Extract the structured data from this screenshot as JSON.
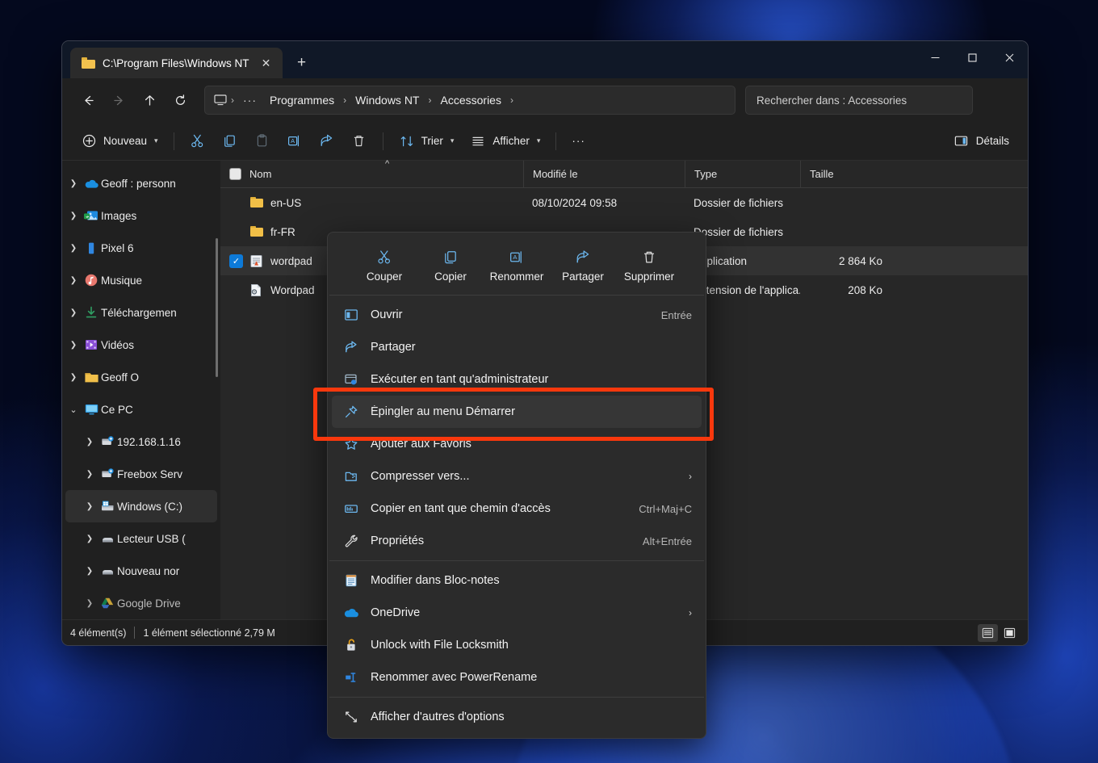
{
  "window": {
    "tab_title": "C:\\Program Files\\Windows NT",
    "tab_close_label": "✕",
    "new_tab_label": "+",
    "minimize_label": "Réduire",
    "maximize_label": "Agrandir",
    "close_label": "Fermer"
  },
  "nav": {
    "back_label": "Précédent",
    "forward_label": "Suivant",
    "up_label": "Remonter d'un niveau",
    "refresh_label": "Actualiser",
    "breadcrumb": [
      "Programmes",
      "Windows NT",
      "Accessories"
    ],
    "breadcrumb_overflow": "···",
    "separator": "›",
    "search_text": "Rechercher dans : Accessories"
  },
  "toolbar": {
    "new_label": "Nouveau",
    "cut_label": "Couper",
    "copy_label": "Copier",
    "paste_label": "Coller",
    "rename_label": "Renommer",
    "share_label": "Partager",
    "delete_label": "Supprimer",
    "sort_label": "Trier",
    "view_label": "Afficher",
    "more_label": "···",
    "details_label": "Détails"
  },
  "sidebar": {
    "items": [
      {
        "label": "Geoff : personn",
        "icon": "onedrive-cloud-icon",
        "expanded": false,
        "indent": 0,
        "selected": false
      },
      {
        "label": "Images",
        "icon": "pictures-icon",
        "expanded": false,
        "indent": 0,
        "selected": false
      },
      {
        "label": "Pixel 6",
        "icon": "phone-icon",
        "expanded": false,
        "indent": 0,
        "selected": false
      },
      {
        "label": "Musique",
        "icon": "music-icon",
        "expanded": false,
        "indent": 0,
        "selected": false
      },
      {
        "label": "Téléchargemen",
        "icon": "downloads-icon",
        "expanded": false,
        "indent": 0,
        "selected": false
      },
      {
        "label": "Vidéos",
        "icon": "videos-icon",
        "expanded": false,
        "indent": 0,
        "selected": false
      },
      {
        "label": "Geoff O",
        "icon": "folder-icon",
        "expanded": false,
        "indent": 0,
        "selected": false
      },
      {
        "label": "Ce PC",
        "icon": "this-pc-icon",
        "expanded": true,
        "indent": 0,
        "selected": false
      },
      {
        "label": "192.168.1.16",
        "icon": "network-drive-icon",
        "expanded": false,
        "indent": 1,
        "selected": false
      },
      {
        "label": "Freebox Serv",
        "icon": "network-drive-icon",
        "expanded": false,
        "indent": 1,
        "selected": false
      },
      {
        "label": "Windows (C:)",
        "icon": "windows-drive-icon",
        "expanded": false,
        "indent": 1,
        "selected": true
      },
      {
        "label": "Lecteur USB (",
        "icon": "usb-drive-icon",
        "expanded": false,
        "indent": 1,
        "selected": false
      },
      {
        "label": "Nouveau nor",
        "icon": "usb-drive-icon",
        "expanded": false,
        "indent": 1,
        "selected": false
      },
      {
        "label": "Google Drive",
        "icon": "google-drive-icon",
        "expanded": false,
        "indent": 1,
        "selected": false
      }
    ]
  },
  "filelist": {
    "columns": [
      "Nom",
      "Modifié le",
      "Type",
      "Taille"
    ],
    "rows": [
      {
        "name": "en-US",
        "modified": "08/10/2024 09:58",
        "type": "Dossier de fichiers",
        "size": "",
        "icon": "folder-icon",
        "selected": false,
        "checked": false
      },
      {
        "name": "fr-FR",
        "modified": "",
        "type": "Dossier de fichiers",
        "size": "",
        "icon": "folder-icon",
        "selected": false,
        "checked": false
      },
      {
        "name": "wordpad",
        "modified": "",
        "type": "Application",
        "size": "2 864 Ko",
        "icon": "wordpad-app-icon",
        "selected": true,
        "checked": true
      },
      {
        "name": "Wordpad",
        "modified": "",
        "type": "Extension de l'applica...",
        "size": "208 Ko",
        "icon": "dll-file-icon",
        "selected": false,
        "checked": false
      }
    ]
  },
  "statusbar": {
    "count_text": "4 élément(s)",
    "selection_text": "1 élément sélectionné  2,79 M",
    "view_details_label": "Affichage Détails",
    "view_large_label": "Grandes icônes"
  },
  "context_menu": {
    "top_actions": [
      {
        "label": "Couper",
        "icon": "scissors-icon"
      },
      {
        "label": "Copier",
        "icon": "copy-icon"
      },
      {
        "label": "Renommer",
        "icon": "rename-icon"
      },
      {
        "label": "Partager",
        "icon": "share-icon"
      },
      {
        "label": "Supprimer",
        "icon": "trash-icon"
      }
    ],
    "items": [
      {
        "label": "Ouvrir",
        "icon": "open-window-icon",
        "accel": "Entrée",
        "submenu": false,
        "highlighted": false,
        "divider_after": false
      },
      {
        "label": "Partager",
        "icon": "share-icon",
        "accel": "",
        "submenu": false,
        "highlighted": false,
        "divider_after": false
      },
      {
        "label": "Exécuter en tant qu'administrateur",
        "icon": "shield-run-icon",
        "accel": "",
        "submenu": false,
        "highlighted": false,
        "divider_after": false
      },
      {
        "label": "Épingler au menu Démarrer",
        "icon": "pin-icon",
        "accel": "",
        "submenu": false,
        "highlighted": true,
        "divider_after": false
      },
      {
        "label": "Ajouter aux Favoris",
        "icon": "star-icon",
        "accel": "",
        "submenu": false,
        "highlighted": false,
        "divider_after": false
      },
      {
        "label": "Compresser vers...",
        "icon": "zip-icon",
        "accel": "",
        "submenu": true,
        "highlighted": false,
        "divider_after": false
      },
      {
        "label": "Copier en tant que chemin d'accès",
        "icon": "copy-path-icon",
        "accel": "Ctrl+Maj+C",
        "submenu": false,
        "highlighted": false,
        "divider_after": false
      },
      {
        "label": "Propriétés",
        "icon": "wrench-icon",
        "accel": "Alt+Entrée",
        "submenu": false,
        "highlighted": false,
        "divider_after": true
      },
      {
        "label": "Modifier dans Bloc-notes",
        "icon": "notepad-icon",
        "accel": "",
        "submenu": false,
        "highlighted": false,
        "divider_after": false
      },
      {
        "label": "OneDrive",
        "icon": "onedrive-cloud-icon",
        "accel": "",
        "submenu": true,
        "highlighted": false,
        "divider_after": false
      },
      {
        "label": "Unlock with File Locksmith",
        "icon": "padlock-icon",
        "accel": "",
        "submenu": false,
        "highlighted": false,
        "divider_after": false
      },
      {
        "label": "Renommer avec PowerRename",
        "icon": "powerrename-icon",
        "accel": "",
        "submenu": false,
        "highlighted": false,
        "divider_after": true
      },
      {
        "label": "Afficher d'autres d'options",
        "icon": "more-options-icon",
        "accel": "",
        "submenu": false,
        "highlighted": false,
        "divider_after": false
      }
    ],
    "submenu_arrow": "›"
  },
  "annotation": {
    "highlight_color": "#f8380d",
    "highlight_target": "Épingler au menu Démarrer"
  }
}
